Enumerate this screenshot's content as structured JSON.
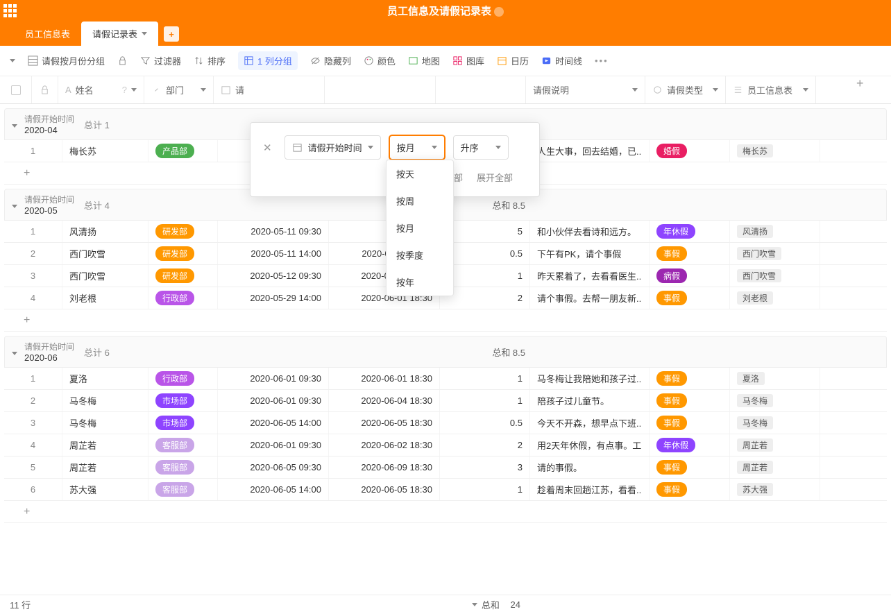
{
  "header": {
    "title": "员工信息及请假记录表"
  },
  "tabs": {
    "employee": "员工信息表",
    "leave": "请假记录表"
  },
  "toolbar": {
    "view_name": "请假按月份分组",
    "filter": "过滤器",
    "sort": "排序",
    "group": "1 列分组",
    "hide": "隐藏列",
    "color": "颜色",
    "map": "地图",
    "gallery": "图库",
    "calendar": "日历",
    "timeline": "时间线"
  },
  "columns": {
    "name": "姓名",
    "dept": "部门",
    "start": "请",
    "desc": "请假说明",
    "type": "请假类型",
    "emp": "员工信息表"
  },
  "group_config": {
    "field": "请假开始时间",
    "granularity": "按月",
    "order": "升序",
    "collapse": "叠全部",
    "expand": "展开全部",
    "options": [
      "按天",
      "按周",
      "按月",
      "按季度",
      "按年"
    ]
  },
  "groups": [
    {
      "label": "请假开始时间",
      "month": "2020-04",
      "count_label": "总计 1",
      "sum_label": "",
      "rows": [
        {
          "idx": "1",
          "name": "梅长苏",
          "dept": "产品部",
          "dept_color": "#4caf50",
          "start": "",
          "end": "",
          "days": "",
          "desc": "人生大事，回去结婚，已..",
          "type": "婚假",
          "type_color": "#e91e63",
          "emp": "梅长苏"
        }
      ]
    },
    {
      "label": "请假开始时间",
      "month": "2020-05",
      "count_label": "总计 4",
      "sum_label": "总和 8.5",
      "rows": [
        {
          "idx": "1",
          "name": "风清扬",
          "dept": "研发部",
          "dept_color": "#ff9800",
          "start": "2020-05-11 09:30",
          "end": "2020-0",
          "days": "5",
          "desc": "和小伙伴去看诗和远方。",
          "type": "年休假",
          "type_color": "#8e44ff",
          "emp": "风清扬"
        },
        {
          "idx": "2",
          "name": "西门吹雪",
          "dept": "研发部",
          "dept_color": "#ff9800",
          "start": "2020-05-11 14:00",
          "end": "2020-05-11 18:30",
          "days": "0.5",
          "desc": "下午有PK，请个事假",
          "type": "事假",
          "type_color": "#ff9800",
          "emp": "西门吹雪"
        },
        {
          "idx": "3",
          "name": "西门吹雪",
          "dept": "研发部",
          "dept_color": "#ff9800",
          "start": "2020-05-12 09:30",
          "end": "2020-05-12 18:30",
          "days": "1",
          "desc": "昨天累着了，去看看医生..",
          "type": "病假",
          "type_color": "#9c27b0",
          "emp": "西门吹雪"
        },
        {
          "idx": "4",
          "name": "刘老根",
          "dept": "行政部",
          "dept_color": "#b955e8",
          "start": "2020-05-29 14:00",
          "end": "2020-06-01 18:30",
          "days": "2",
          "desc": "请个事假。去帮一朋友新..",
          "type": "事假",
          "type_color": "#ff9800",
          "emp": "刘老根"
        }
      ]
    },
    {
      "label": "请假开始时间",
      "month": "2020-06",
      "count_label": "总计 6",
      "sum_label": "总和 8.5",
      "rows": [
        {
          "idx": "1",
          "name": "夏洛",
          "dept": "行政部",
          "dept_color": "#b955e8",
          "start": "2020-06-01 09:30",
          "end": "2020-06-01 18:30",
          "days": "1",
          "desc": "马冬梅让我陪她和孩子过..",
          "type": "事假",
          "type_color": "#ff9800",
          "emp": "夏洛"
        },
        {
          "idx": "2",
          "name": "马冬梅",
          "dept": "市场部",
          "dept_color": "#8e44ff",
          "start": "2020-06-01 09:30",
          "end": "2020-06-04 18:30",
          "days": "1",
          "desc": "陪孩子过儿童节。",
          "type": "事假",
          "type_color": "#ff9800",
          "emp": "马冬梅"
        },
        {
          "idx": "3",
          "name": "马冬梅",
          "dept": "市场部",
          "dept_color": "#8e44ff",
          "start": "2020-06-05 14:00",
          "end": "2020-06-05 18:30",
          "days": "0.5",
          "desc": "今天不开森，想早点下班..",
          "type": "事假",
          "type_color": "#ff9800",
          "emp": "马冬梅"
        },
        {
          "idx": "4",
          "name": "周芷若",
          "dept": "客服部",
          "dept_color": "#c9a5e8",
          "start": "2020-06-01 09:30",
          "end": "2020-06-02 18:30",
          "days": "2",
          "desc": "用2天年休假，有点事。工",
          "type": "年休假",
          "type_color": "#8e44ff",
          "emp": "周芷若"
        },
        {
          "idx": "5",
          "name": "周芷若",
          "dept": "客服部",
          "dept_color": "#c9a5e8",
          "start": "2020-06-05 09:30",
          "end": "2020-06-09 18:30",
          "days": "3",
          "desc": "请的事假。",
          "type": "事假",
          "type_color": "#ff9800",
          "emp": "周芷若"
        },
        {
          "idx": "6",
          "name": "苏大强",
          "dept": "客服部",
          "dept_color": "#c9a5e8",
          "start": "2020-06-05 14:00",
          "end": "2020-06-05 18:30",
          "days": "1",
          "desc": "趁着周末回趟江苏，看看..",
          "type": "事假",
          "type_color": "#ff9800",
          "emp": "苏大强"
        }
      ]
    }
  ],
  "footer": {
    "rows": "11 行",
    "total_label": "总和",
    "total": "24"
  }
}
